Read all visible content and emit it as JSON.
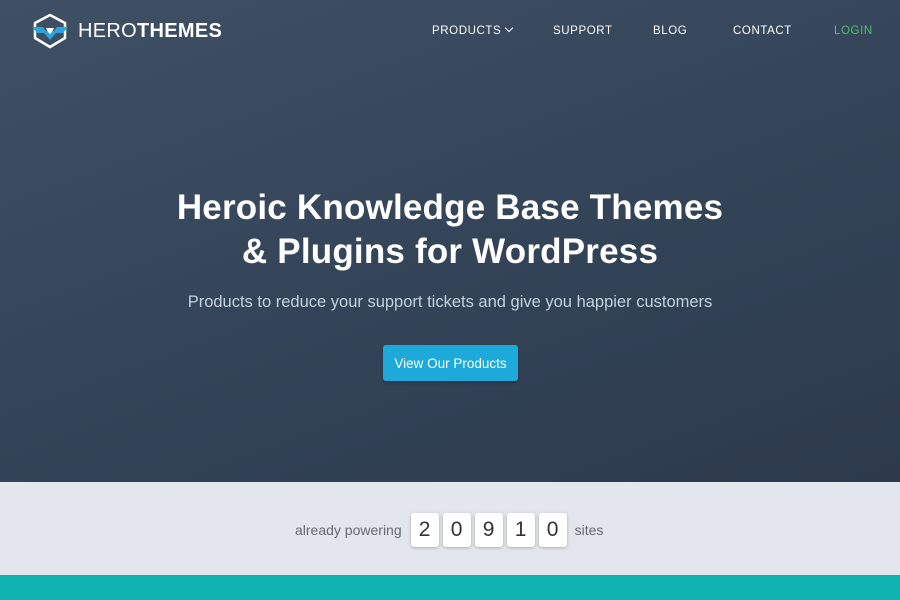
{
  "brand": {
    "name_light": "HERO",
    "name_bold": "THEMES"
  },
  "nav": {
    "products": "PRODUCTS",
    "support": "SUPPORT",
    "blog": "BLOG",
    "contact": "CONTACT",
    "login": "LOGIN"
  },
  "hero": {
    "headline_line1": "Heroic Knowledge Base Themes",
    "headline_line2": "& Plugins for WordPress",
    "subheadline": "Products to reduce your support tickets and give you happier customers",
    "cta_label": "View Our Products"
  },
  "stats": {
    "prefix": "already powering",
    "digits": [
      "2",
      "0",
      "9",
      "1",
      "0"
    ],
    "suffix": "sites"
  },
  "colors": {
    "hero_background": "#35465a",
    "cta": "#1da9da",
    "login": "#4cbf6a",
    "stats_background": "#e3e6ec",
    "footer_bar": "#10b3b0"
  }
}
